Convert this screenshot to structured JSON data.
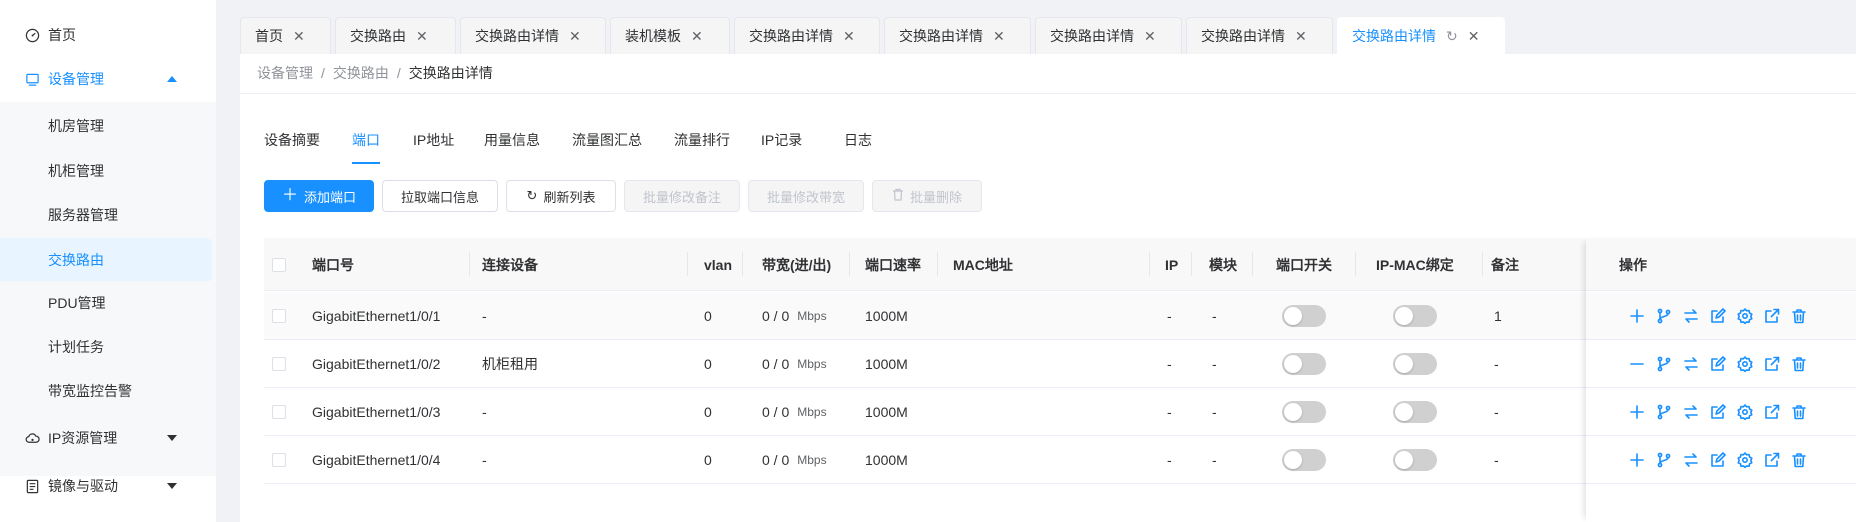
{
  "sidebar": {
    "items": [
      {
        "label": "首页",
        "icon": "dashboard-icon"
      },
      {
        "label": "设备管理",
        "icon": "monitor-icon",
        "expanded": true
      },
      {
        "label": "IP资源管理",
        "icon": "cloud-icon"
      },
      {
        "label": "镜像与驱动",
        "icon": "image-icon"
      }
    ],
    "sub_items": [
      "机房管理",
      "机柜管理",
      "服务器管理",
      "交换路由",
      "PDU管理",
      "计划任务",
      "带宽监控告警"
    ],
    "active_sub": "交换路由"
  },
  "tabs": [
    {
      "label": "首页"
    },
    {
      "label": "交换路由"
    },
    {
      "label": "交换路由详情"
    },
    {
      "label": "装机模板"
    },
    {
      "label": "交换路由详情"
    },
    {
      "label": "交换路由详情"
    },
    {
      "label": "交换路由详情"
    },
    {
      "label": "交换路由详情"
    },
    {
      "label": "交换路由详情",
      "active": true
    }
  ],
  "breadcrumb": {
    "items": [
      "设备管理",
      "交换路由",
      "交换路由详情"
    ],
    "separator": "/"
  },
  "subtabs": [
    {
      "label": "设备摘要"
    },
    {
      "label": "端口",
      "active": true
    },
    {
      "label": "IP地址"
    },
    {
      "label": "用量信息"
    },
    {
      "label": "流量图汇总"
    },
    {
      "label": "流量排行"
    },
    {
      "label": "IP记录"
    },
    {
      "label": "日志"
    }
  ],
  "toolbar": {
    "add_port": "添加端口",
    "pull_port_info": "拉取端口信息",
    "refresh_list": "刷新列表",
    "batch_edit_remark": "批量修改备注",
    "batch_edit_bandwidth": "批量修改带宽",
    "batch_delete": "批量删除"
  },
  "table": {
    "headers": {
      "port": "端口号",
      "device": "连接设备",
      "vlan": "vlan",
      "bandwidth": "带宽(进/出)",
      "speed": "端口速率",
      "mac": "MAC地址",
      "ip": "IP",
      "module": "模块",
      "port_switch": "端口开关",
      "ipmac_bind": "IP-MAC绑定",
      "remark": "备注",
      "ops": "操作"
    },
    "bandwidth_unit": "Mbps",
    "rows": [
      {
        "port": "GigabitEthernet1/0/1",
        "device": "-",
        "vlan": "0",
        "bandwidth": "0 / 0",
        "speed": "1000M",
        "mac": "",
        "ip": "-",
        "module": "-",
        "port_switch": false,
        "ipmac_bind": false,
        "remark": "1",
        "first_op": "plus-icon"
      },
      {
        "port": "GigabitEthernet1/0/2",
        "device": "机柜租用",
        "vlan": "0",
        "bandwidth": "0 / 0",
        "speed": "1000M",
        "mac": "",
        "ip": "-",
        "module": "-",
        "port_switch": false,
        "ipmac_bind": false,
        "remark": "-",
        "first_op": "minus-icon"
      },
      {
        "port": "GigabitEthernet1/0/3",
        "device": "-",
        "vlan": "0",
        "bandwidth": "0 / 0",
        "speed": "1000M",
        "mac": "",
        "ip": "-",
        "module": "-",
        "port_switch": false,
        "ipmac_bind": false,
        "remark": "-",
        "first_op": "plus-icon"
      },
      {
        "port": "GigabitEthernet1/0/4",
        "device": "-",
        "vlan": "0",
        "bandwidth": "0 / 0",
        "speed": "1000M",
        "mac": "",
        "ip": "-",
        "module": "-",
        "port_switch": false,
        "ipmac_bind": false,
        "remark": "-",
        "first_op": "plus-icon"
      }
    ],
    "op_icons": [
      "branch-icon",
      "swap-icon",
      "edit-icon",
      "settings-icon",
      "external-link-icon",
      "trash-icon"
    ]
  },
  "colors": {
    "primary": "#1890ff",
    "text": "#303133",
    "muted": "#909399",
    "disabled": "#c0c4cc"
  }
}
